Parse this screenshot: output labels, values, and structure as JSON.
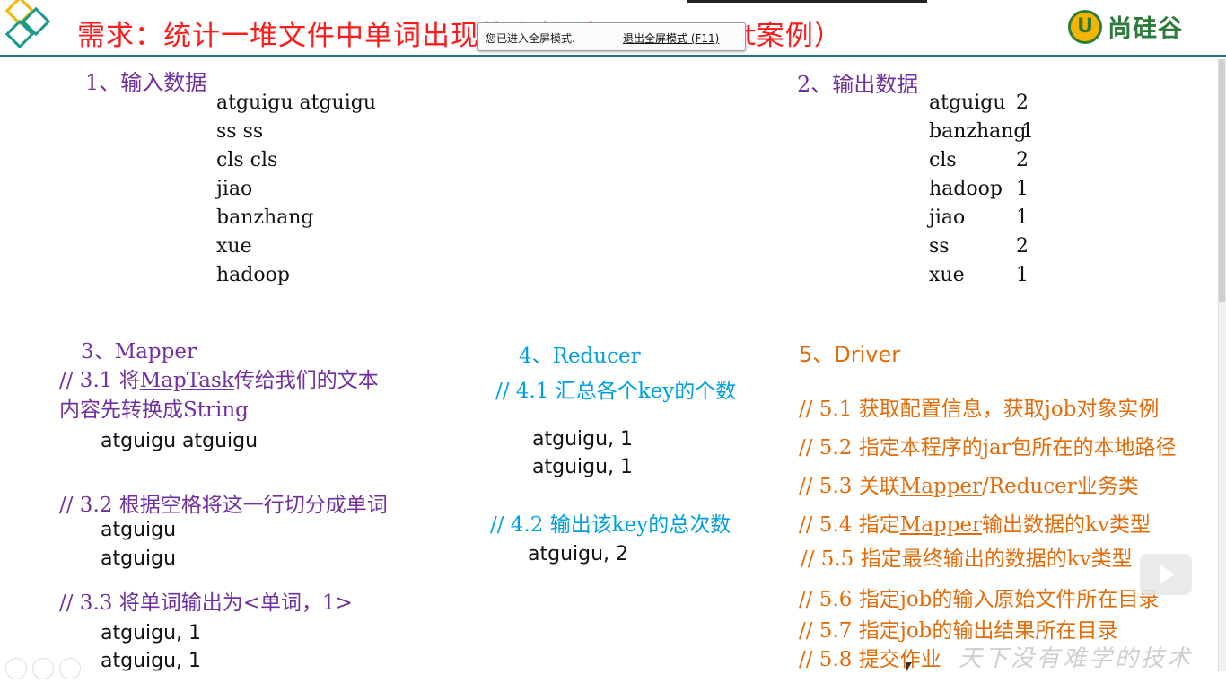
{
  "slide": {
    "title": "需求：统计一堆文件中单词出现的个数（WordCount案例）",
    "brand_mark": "U",
    "brand": "尚硅谷",
    "watermark": "天下没有难学的技术"
  },
  "fullscreen_notice": {
    "message": "您已进入全屏模式.",
    "exit_label": "退出全屏模式 (F11)"
  },
  "input_section": {
    "heading": "1、输入数据",
    "lines": [
      "atguigu atguigu",
      "ss ss",
      "cls cls",
      "jiao",
      "banzhang",
      "xue",
      "hadoop"
    ]
  },
  "output_section": {
    "heading": "2、输出数据",
    "rows": [
      {
        "word": "atguigu",
        "count": "2"
      },
      {
        "word": "banzhang",
        "count": "1"
      },
      {
        "word": "cls",
        "count": "2"
      },
      {
        "word": "hadoop",
        "count": "1"
      },
      {
        "word": "jiao",
        "count": "1"
      },
      {
        "word": "ss",
        "count": "2"
      },
      {
        "word": "xue",
        "count": "1"
      }
    ]
  },
  "mapper": {
    "heading": "3、Mapper",
    "step1_prefix": "//  3.1  将",
    "step1_link": "MapTask",
    "step1_suffix": "传给我们的文本",
    "step1_line2": "内容先转换成String",
    "step1_example": "atguigu atguigu",
    "step2": "// 3.2 根据空格将这一行切分成单词",
    "step2_examples": [
      "atguigu",
      "atguigu"
    ],
    "step3": "// 3.3 将单词输出为<单词，1>",
    "step3_examples": [
      "atguigu, 1",
      "atguigu, 1"
    ]
  },
  "reducer": {
    "heading": "4、Reducer",
    "step1": "// 4.1 汇总各个key的个数",
    "step1_examples": [
      "atguigu, 1",
      "atguigu, 1"
    ],
    "step2": "// 4.2  输出该key的总次数",
    "step2_example": "atguigu, 2"
  },
  "driver": {
    "heading": "5、Driver",
    "steps": [
      {
        "prefix": "// 5.1 获取配置信息，获取job对象实例",
        "link": "",
        "suffix": ""
      },
      {
        "prefix": "// 5.2 指定本程序的jar包所在的本地路径",
        "link": "",
        "suffix": ""
      },
      {
        "prefix": "// 5.3 关联",
        "link": "Mapper",
        "suffix": "/Reducer业务类"
      },
      {
        "prefix": "// 5.4 指定",
        "link": "Mapper",
        "suffix": "输出数据的kv类型"
      },
      {
        "prefix": "// 5.5 指定最终输出的数据的kv类型",
        "link": "",
        "suffix": ""
      },
      {
        "prefix": "// 5.6 指定job的输入原始文件所在目录",
        "link": "",
        "suffix": ""
      },
      {
        "prefix": "// 5.7  指定job的输出结果所在目录",
        "link": "",
        "suffix": ""
      },
      {
        "prefix": "// 5.8 提交作业",
        "link": "",
        "suffix": ""
      }
    ]
  },
  "colors": {
    "title": "#ff1a1a",
    "heading": "#7030a0",
    "reducer": "#00a0e0",
    "driver": "#e36c0a",
    "rule": "#1a7a78"
  },
  "icons": {
    "logo": "diamond-logo-icon",
    "brand": "brand-u-icon",
    "play": "play-icon",
    "cursor": "mouse-cursor-icon"
  }
}
